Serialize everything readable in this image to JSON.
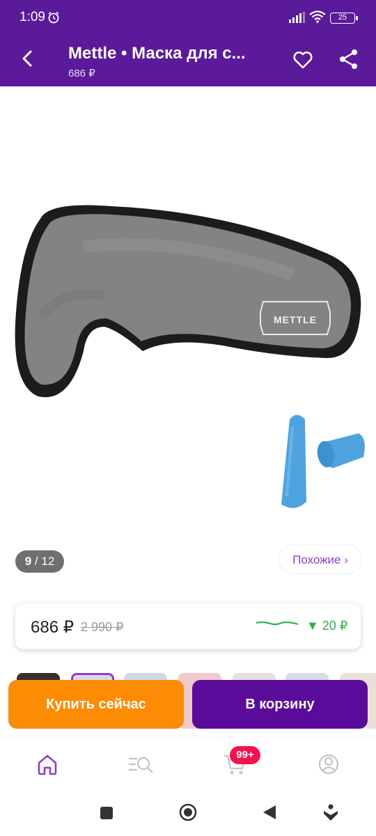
{
  "status_bar": {
    "time": "1:09",
    "battery": "25"
  },
  "app_bar": {
    "title": "Mettle • Маска для с...",
    "subtitle": "686 ₽"
  },
  "gallery": {
    "counter_current": "9",
    "counter_total": "/ 12",
    "similar_label": "Похожие ›",
    "logo_text": "METTLE"
  },
  "price": {
    "current": "686 ₽",
    "old": "2 990 ₽",
    "drop": "▼ 20 ₽"
  },
  "actions": {
    "buy_now": "Купить сейчас",
    "add_to_cart": "В корзину"
  },
  "bottom_nav": {
    "cart_badge": "99+"
  },
  "colors": {
    "brand": "#5b1a99",
    "buy": "#fd8c05",
    "cart": "#5b0b99",
    "accent_text": "#8b3fc7",
    "price_drop": "#2db14a",
    "badge": "#f0134d"
  }
}
